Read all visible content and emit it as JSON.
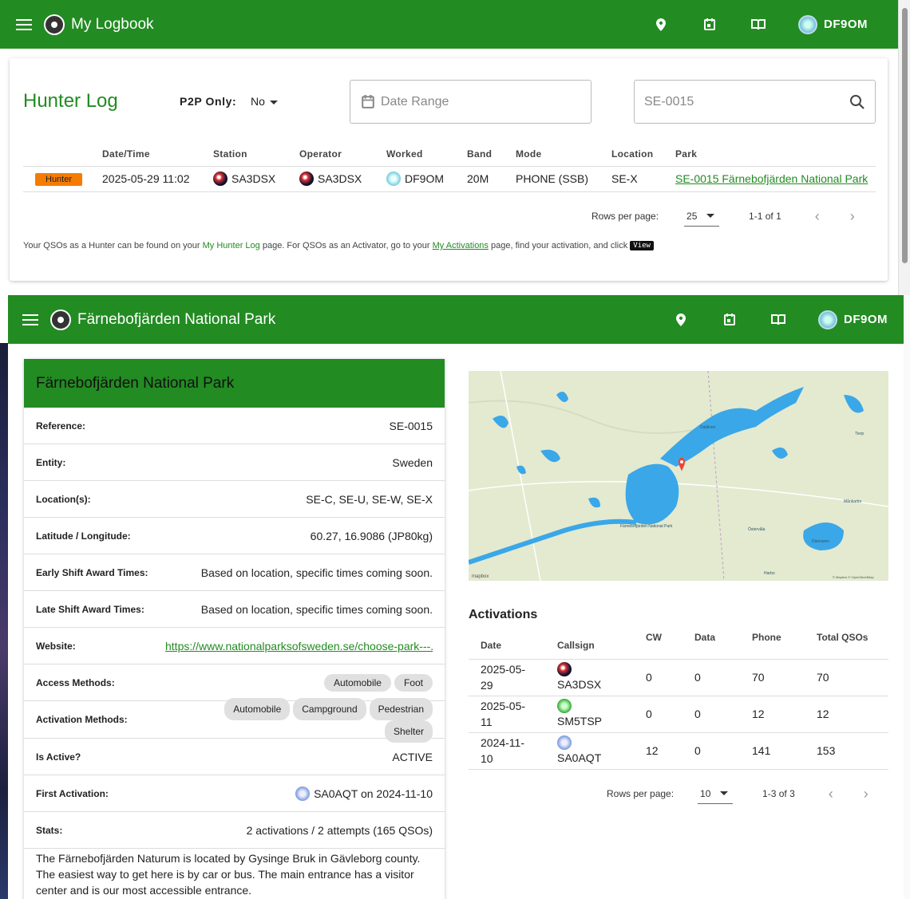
{
  "appbar1": {
    "title": "My Logbook",
    "callsign": "DF9OM"
  },
  "hunter": {
    "title": "Hunter Log",
    "p2p_label": "P2P Only:",
    "p2p_value": "No",
    "date_placeholder": "Date Range",
    "search_value": "SE-0015",
    "columns": [
      "Date/Time",
      "Station",
      "Operator",
      "Worked",
      "Band",
      "Mode",
      "Location",
      "Park"
    ],
    "rows": [
      {
        "badge": "Hunter",
        "datetime": "2025-05-29 11:02",
        "station": "SA3DSX",
        "operator": "SA3DSX",
        "worked": "DF9OM",
        "band": "20M",
        "mode": "PHONE (SSB)",
        "location": "SE-X",
        "park": "SE-0015 Färnebofjärden National Park"
      }
    ],
    "rows_per_page_label": "Rows per page:",
    "rows_per_page": "25",
    "range": "1-1 of 1",
    "note": {
      "t1": "Your QSOs as a Hunter can be found on your ",
      "link1": "My Hunter Log",
      "t2": " page. For QSOs as an Activator, go to your ",
      "link2": "My Activations",
      "t3": " page, find your activation, and click ",
      "btn": "View"
    }
  },
  "appbar2": {
    "title": "Färnebofjärden National Park",
    "callsign": "DF9OM"
  },
  "park": {
    "title": "Färnebofjärden National Park",
    "reference_label": "Reference:",
    "reference": "SE-0015",
    "entity_label": "Entity:",
    "entity": "Sweden",
    "locations_label": "Location(s):",
    "locations": "SE-C, SE-U, SE-W, SE-X",
    "latlon_label": "Latitude / Longitude:",
    "latlon": "60.27, 16.9086 (JP80kg)",
    "early_label": "Early Shift Award Times:",
    "early": "Based on location, specific times coming soon.",
    "late_label": "Late Shift Award Times:",
    "late": "Based on location, specific times coming soon.",
    "website_label": "Website:",
    "website": "https://www.nationalparksofsweden.se/choose-park---...",
    "access_label": "Access Methods:",
    "access": [
      "Automobile",
      "Foot"
    ],
    "activation_label": "Activation Methods:",
    "activation": [
      "Automobile",
      "Campground",
      "Pedestrian",
      "Shelter"
    ],
    "active_label": "Is Active?",
    "active": "ACTIVE",
    "first_label": "First Activation:",
    "first": "SA0AQT on 2024-11-10",
    "stats_label": "Stats:",
    "stats": "2 activations / 2 attempts (165 QSOs)",
    "description": "The Färnebofjärden Naturum is located by Gysinge Bruk in Gävleborg county. The easiest way to get here is by car or bus. The main entrance has a visitor center and is our most accessible entrance."
  },
  "map": {
    "labels": [
      "Dalälven",
      "Färnebofjärden National Park",
      "Östervåla",
      "Dännaren",
      "Harbo",
      "Månkarbo",
      "Tierp"
    ],
    "attribution": "© Mapbox © OpenStreetMap",
    "logo": "mapbox"
  },
  "activations": {
    "title": "Activations",
    "columns": [
      "Date",
      "Callsign",
      "CW",
      "Data",
      "Phone",
      "Total QSOs"
    ],
    "rows": [
      {
        "date": "2025-05-29",
        "callsign": "SA3DSX",
        "cw": "0",
        "data": "0",
        "phone": "70",
        "total": "70",
        "flag": "se"
      },
      {
        "date": "2025-05-11",
        "callsign": "SM5TSP",
        "cw": "0",
        "data": "0",
        "phone": "12",
        "total": "12",
        "flag": "sm"
      },
      {
        "date": "2024-11-10",
        "callsign": "SA0AQT",
        "cw": "12",
        "data": "0",
        "phone": "141",
        "total": "153",
        "flag": "aq"
      }
    ],
    "rows_per_page_label": "Rows per page:",
    "rows_per_page": "10",
    "range": "1-3 of 3"
  },
  "icons": [
    "menu-icon",
    "logo-icon",
    "map-pin-icon",
    "calendar-icon",
    "book-icon",
    "avatar-icon",
    "search-icon",
    "chevron-left-icon",
    "chevron-right-icon"
  ]
}
